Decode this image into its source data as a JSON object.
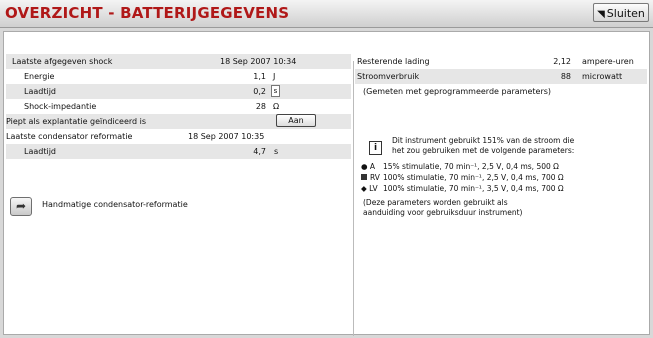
{
  "window": {
    "title": "OVERZICHT - BATTERIJGEGEVENS",
    "close_label": "Sluiten"
  },
  "left": {
    "last_shock": {
      "label": "Laatste afgegeven shock",
      "value": "18 Sep 2007 10:34"
    },
    "energy": {
      "label": "Energie",
      "value": "1,1",
      "unit": "J"
    },
    "charge_time": {
      "label": "Laadtijd",
      "value": "0,2",
      "unit": "s"
    },
    "shock_impedance": {
      "label": "Shock-impedantie",
      "value": "28",
      "unit": "Ω"
    },
    "beep": {
      "label": "Piept als explantatie geïndiceerd is",
      "value": "Aan"
    },
    "last_reform": {
      "label": "Laatste condensator reformatie",
      "value": "18 Sep 2007 10:35"
    },
    "reform_charge_time": {
      "label": "Laadtijd",
      "value": "4,7",
      "unit": "s"
    },
    "manual_reform_label": "Handmatige condensator-reformatie"
  },
  "right": {
    "remaining_charge": {
      "label": "Resterende lading",
      "value": "2,12",
      "unit": "ampere-uren"
    },
    "current_drain": {
      "label": "Stroomverbruik",
      "value": "88",
      "unit": "microwatt"
    },
    "measured_note": "(Gemeten met geprogrammeerde parameters)",
    "info_line1": "Dit instrument gebruikt 151% van de stroom die",
    "info_line2": "het zou gebruiken met de volgende parameters:",
    "param_a": {
      "marker": "● A",
      "text": "15% stimulatie, 70 min⁻¹, 2,5 V, 0,4 ms, 500 Ω"
    },
    "param_rv": {
      "marker": "RV",
      "text": "100% stimulatie, 70 min⁻¹, 2,5 V, 0,4 ms, 700 Ω"
    },
    "param_lv": {
      "marker": "◆ LV",
      "text": "100% stimulatie, 70 min⁻¹, 3,5 V, 0,4 ms, 700 Ω"
    },
    "footnote_line1": "(Deze parameters worden gebruikt als",
    "footnote_line2": "aanduiding voor gebruiksduur instrument)"
  }
}
